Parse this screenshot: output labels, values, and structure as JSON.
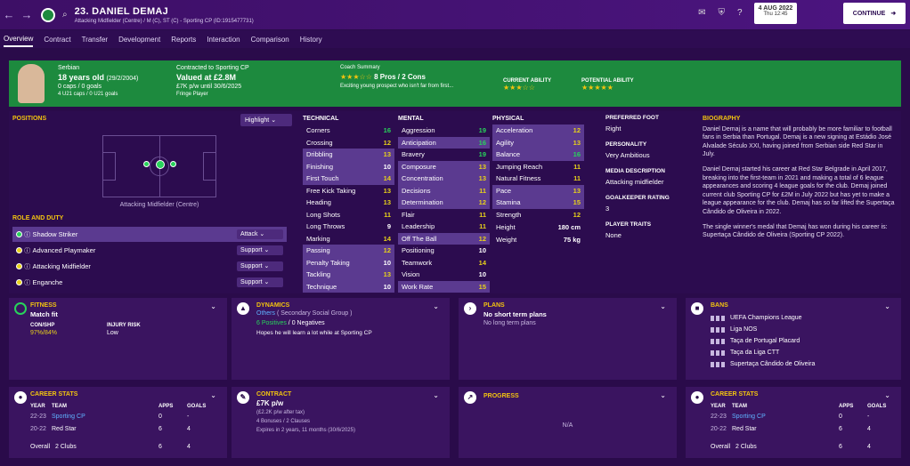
{
  "header": {
    "back": "←",
    "forward": "→",
    "name": "23. DANIEL DEMAJ",
    "sub": "Attacking Midfielder (Centre) / M (C), ST (C) - Sporting CP (ID:1915477731)",
    "date": "4 AUG 2022",
    "time": "Thu 12:45",
    "continue": "CONTINUE",
    "fm": "FM"
  },
  "tabs": [
    "Overview",
    "Contract",
    "Transfer",
    "Development",
    "Reports",
    "Interaction",
    "Comparison",
    "History"
  ],
  "banner": {
    "nation": "Serbian",
    "age": "18 years old",
    "dob": "(29/2/2004)",
    "caps": "0 caps / 0 goals",
    "u21": "4 U21 caps / 0 U21 goals",
    "contract_label": "Contracted to Sporting CP",
    "value": "Valued at £2.8M",
    "wage": "£7K p/w until 30/6/2025",
    "squad": "Fringe Player",
    "coach_label": "Coach Summary",
    "pros": "8 Pros / 2 Cons",
    "coach_text": "Exciting young prospect who isn't far from first...",
    "ca": "CURRENT ABILITY",
    "pa": "POTENTIAL ABILITY"
  },
  "positions": {
    "title": "POSITIONS",
    "highlight": "Highlight",
    "pos": "Attacking Midfielder (Centre)"
  },
  "roles": {
    "title": "ROLE AND DUTY",
    "items": [
      {
        "name": "Shadow Striker",
        "duty": "Attack"
      },
      {
        "name": "Advanced Playmaker",
        "duty": "Support"
      },
      {
        "name": "Attacking Midfielder",
        "duty": "Support"
      },
      {
        "name": "Enganche",
        "duty": "Support"
      }
    ]
  },
  "technical": {
    "title": "TECHNICAL",
    "rows": [
      [
        "Corners",
        "16"
      ],
      [
        "Crossing",
        "12"
      ],
      [
        "Dribbling",
        "13"
      ],
      [
        "Finishing",
        "10"
      ],
      [
        "First Touch",
        "14"
      ],
      [
        "Free Kick Taking",
        "13"
      ],
      [
        "Heading",
        "13"
      ],
      [
        "Long Shots",
        "11"
      ],
      [
        "Long Throws",
        "9"
      ],
      [
        "Marking",
        "14"
      ],
      [
        "Passing",
        "12"
      ],
      [
        "Penalty Taking",
        "10"
      ],
      [
        "Tackling",
        "13"
      ],
      [
        "Technique",
        "10"
      ]
    ]
  },
  "mental": {
    "title": "MENTAL",
    "rows": [
      [
        "Aggression",
        "19"
      ],
      [
        "Anticipation",
        "16"
      ],
      [
        "Bravery",
        "19"
      ],
      [
        "Composure",
        "13"
      ],
      [
        "Concentration",
        "13"
      ],
      [
        "Decisions",
        "11"
      ],
      [
        "Determination",
        "12"
      ],
      [
        "Flair",
        "11"
      ],
      [
        "Leadership",
        "11"
      ],
      [
        "Off The Ball",
        "12"
      ],
      [
        "Positioning",
        "10"
      ],
      [
        "Teamwork",
        "14"
      ],
      [
        "Vision",
        "10"
      ],
      [
        "Work Rate",
        "15"
      ]
    ]
  },
  "physical": {
    "title": "PHYSICAL",
    "rows": [
      [
        "Acceleration",
        "12"
      ],
      [
        "Agility",
        "13"
      ],
      [
        "Balance",
        "16"
      ],
      [
        "Jumping Reach",
        "11"
      ],
      [
        "Natural Fitness",
        "11"
      ],
      [
        "Pace",
        "13"
      ],
      [
        "Stamina",
        "15"
      ],
      [
        "Strength",
        "12"
      ]
    ],
    "height_l": "Height",
    "height": "180 cm",
    "weight_l": "Weight",
    "weight": "75 kg"
  },
  "info": {
    "foot_l": "PREFERRED FOOT",
    "foot": "Right",
    "pers_l": "PERSONALITY",
    "pers": "Very Ambitious",
    "media_l": "MEDIA DESCRIPTION",
    "media": "Attacking midfielder",
    "gk_l": "GOALKEEPER RATING",
    "gk": "3",
    "traits_l": "PLAYER TRAITS",
    "traits": "None"
  },
  "bio": {
    "title": "BIOGRAPHY",
    "p1": "Daniel Demaj is a name that will probably be more familiar to football fans in Serbia than Portugal. Demaj is a new signing at Estádio José Alvalade Século XXI, having joined from Serbian side Red Star in July.",
    "p2": "Daniel Demaj started his career at Red Star Belgrade in April 2017, breaking into the first-team in 2021 and making a total of 6 league appearances and scoring 4 league goals for the club. Demaj joined current club Sporting CP for £2M in July 2022 but has yet to make a league appearance for the club. Demaj has so far lifted the Supertaça Cândido de Oliveira in 2022.",
    "p3": "The single winner's medal that Demaj has won during his career is: Supertaça Cândido de Oliveira (Sporting CP 2022)."
  },
  "fitness": {
    "title": "FITNESS",
    "status": "Match fit",
    "cs_l": "CON/SHP",
    "cs": "97%/84%",
    "inj_l": "INJURY RISK",
    "inj": "Low"
  },
  "dynamics": {
    "title": "DYNAMICS",
    "group": "Others",
    "group2": "( Secondary Social Group )",
    "pos": "6 Positives",
    "neg": "0 Negatives",
    "note": "Hopes he will learn a lot while at Sporting CP"
  },
  "plans": {
    "title": "PLANS",
    "p1": "No short term plans",
    "p2": "No long term plans"
  },
  "bans": {
    "title": "BANS",
    "items": [
      "UEFA Champions League",
      "Liga NOS",
      "Taça de Portugal Placard",
      "Taça da Liga CTT",
      "Supertaça Cândido de Oliveira"
    ]
  },
  "career": {
    "title": "CAREER STATS",
    "year": "YEAR",
    "team": "TEAM",
    "apps": "APPS",
    "goals": "GOALS",
    "rows": [
      [
        "22-23",
        "Sporting CP",
        "0",
        "-"
      ],
      [
        "20-22",
        "Red Star",
        "6",
        "4"
      ]
    ],
    "overall": "Overall",
    "clubs": "2 Clubs",
    "oapps": "6",
    "ogoals": "4"
  },
  "contract": {
    "title": "CONTRACT",
    "wage": "£7K p/w",
    "tax": "(£2.2K p/w after tax)",
    "bonuses": "4 Bonuses / 2 Clauses",
    "expires": "Expires in 2 years, 11 months (30/6/2025)"
  },
  "progress": {
    "title": "PROGRESS",
    "na": "N/A"
  },
  "career2": {
    "title": "CAREER STATS"
  }
}
